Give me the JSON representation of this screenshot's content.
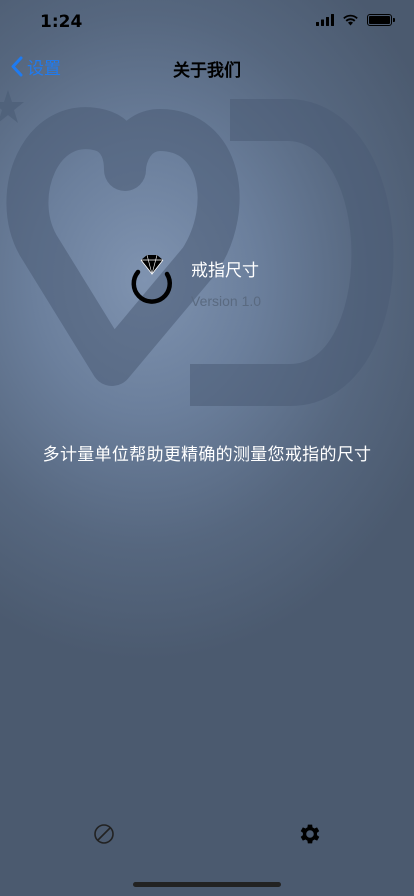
{
  "status_bar": {
    "time": "1:24"
  },
  "nav": {
    "back_label": "设置",
    "title": "关于我们"
  },
  "app": {
    "name": "戒指尺寸",
    "version": "Version 1.0"
  },
  "description": "多计量单位帮助更精确的测量您戒指的尺寸",
  "tabs": [
    {
      "icon": "ring-measure-icon"
    },
    {
      "icon": "gear-icon"
    }
  ],
  "colors": {
    "accent": "#1e7bf2",
    "background": "#5e718c"
  }
}
